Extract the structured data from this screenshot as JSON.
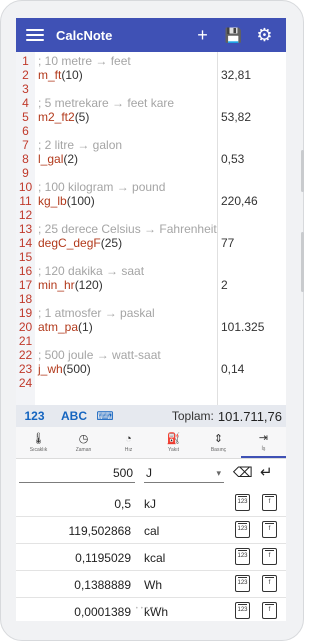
{
  "app": {
    "title": "CalcNote",
    "actions": [
      {
        "name": "add-icon",
        "glyph": "+"
      },
      {
        "name": "save-icon",
        "glyph": "💾"
      },
      {
        "name": "gear-icon",
        "glyph": "⚙"
      }
    ]
  },
  "editor": {
    "lines": [
      {
        "n": "1",
        "kind": "comment",
        "code": "; 10 metre → feet",
        "result": ""
      },
      {
        "n": "2",
        "kind": "expr",
        "fn": "m_ft",
        "arg": "(10)",
        "result": "32,81"
      },
      {
        "n": "3",
        "kind": "blank",
        "code": "",
        "result": ""
      },
      {
        "n": "4",
        "kind": "comment",
        "code": "; 5 metrekare → feet kare",
        "result": ""
      },
      {
        "n": "5",
        "kind": "expr",
        "fn": "m2_ft2",
        "arg": "(5)",
        "result": "53,82"
      },
      {
        "n": "6",
        "kind": "blank",
        "code": "",
        "result": ""
      },
      {
        "n": "7",
        "kind": "comment",
        "code": "; 2 litre → galon",
        "result": ""
      },
      {
        "n": "8",
        "kind": "expr",
        "fn": "l_gal",
        "arg": "(2)",
        "result": "0,53"
      },
      {
        "n": "9",
        "kind": "blank",
        "code": "",
        "result": ""
      },
      {
        "n": "10",
        "kind": "comment",
        "code": "; 100 kilogram → pound",
        "result": ""
      },
      {
        "n": "11",
        "kind": "expr",
        "fn": "kg_lb",
        "arg": "(100)",
        "result": "220,46"
      },
      {
        "n": "12",
        "kind": "blank",
        "code": "",
        "result": ""
      },
      {
        "n": "13",
        "kind": "comment",
        "code": "; 25 derece Celsius → Fahrenheit",
        "result": ""
      },
      {
        "n": "14",
        "kind": "expr",
        "fn": "degC_degF",
        "arg": "(25)",
        "result": "77"
      },
      {
        "n": "15",
        "kind": "blank",
        "code": "",
        "result": ""
      },
      {
        "n": "16",
        "kind": "comment",
        "code": "; 120 dakika → saat",
        "result": ""
      },
      {
        "n": "17",
        "kind": "expr",
        "fn": "min_hr",
        "arg": "(120)",
        "result": "2"
      },
      {
        "n": "18",
        "kind": "blank",
        "code": "",
        "result": ""
      },
      {
        "n": "19",
        "kind": "comment",
        "code": "; 1 atmosfer → paskal",
        "result": ""
      },
      {
        "n": "20",
        "kind": "expr",
        "fn": "atm_pa",
        "arg": "(1)",
        "result": "101.325"
      },
      {
        "n": "21",
        "kind": "blank",
        "code": "",
        "result": ""
      },
      {
        "n": "22",
        "kind": "comment",
        "code": "; 500 joule → watt-saat",
        "result": ""
      },
      {
        "n": "23",
        "kind": "expr",
        "fn": "j_wh",
        "arg": "(500)",
        "result": "0,14"
      },
      {
        "n": "24",
        "kind": "blank",
        "code": "",
        "result": ""
      }
    ]
  },
  "modebar": {
    "num_label": "123",
    "abc_label": "ABC",
    "keyboard_icon": "⌨",
    "total_label": "Toplam:",
    "total_value": "101.711,76"
  },
  "categories": [
    {
      "name": "thermometer-icon",
      "glyph": "🌡",
      "label": "Sıcaklık",
      "active": false
    },
    {
      "name": "clock-icon",
      "glyph": "◷",
      "label": "Zaman",
      "active": false
    },
    {
      "name": "speedometer-icon",
      "glyph": "◔",
      "label": "Hız",
      "active": false
    },
    {
      "name": "fuel-icon",
      "glyph": "⛽",
      "label": "Yakıt",
      "active": false
    },
    {
      "name": "pressure-icon",
      "glyph": "⇕",
      "label": "Basınç",
      "active": false
    },
    {
      "name": "energy-icon",
      "glyph": "⇥",
      "label": "İş",
      "active": true
    }
  ],
  "converter": {
    "input_value": "500",
    "input_unit": "J",
    "clear_glyph": "⌫",
    "enter_glyph": "↵",
    "rows": [
      {
        "value": "0,5",
        "unit": "kJ"
      },
      {
        "value": "119,502868",
        "unit": "cal"
      },
      {
        "value": "0,1195029",
        "unit": "kcal"
      },
      {
        "value": "0,1388889",
        "unit": "Wh"
      },
      {
        "value": "0,0001389",
        "unit": "kWh"
      }
    ],
    "copy_value_label": "123",
    "copy_formula_label": "f"
  }
}
